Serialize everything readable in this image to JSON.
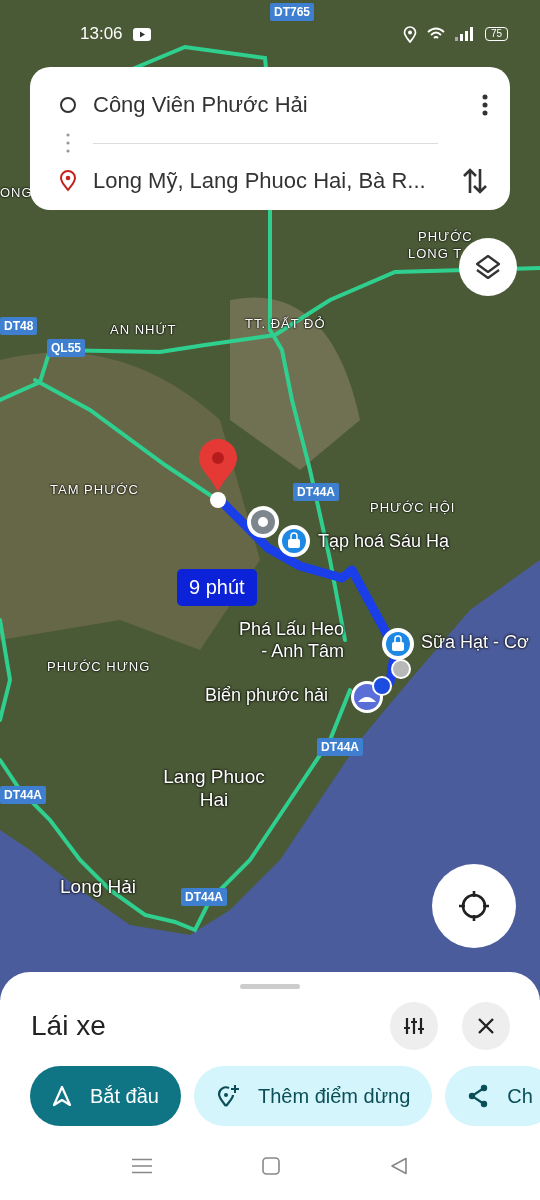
{
  "status_bar": {
    "time": "13:06",
    "battery": "75"
  },
  "directions": {
    "origin": "Công Viên Phước Hải",
    "destination": "Long Mỹ, Lang Phuoc Hai, Bà R..."
  },
  "map": {
    "labels": [
      {
        "kind": "shield",
        "text": "DT765"
      },
      {
        "kind": "area",
        "text": "ONG"
      },
      {
        "kind": "area",
        "text": "PHƯỚC"
      },
      {
        "kind": "area",
        "text": "LONG T"
      },
      {
        "kind": "shield",
        "text": "DT48"
      },
      {
        "kind": "area",
        "text": "AN NHỨT"
      },
      {
        "kind": "area",
        "text": "TT. ĐẤT ĐỎ"
      },
      {
        "kind": "shield",
        "text": "QL55"
      },
      {
        "kind": "area",
        "text": "TAM PHƯỚC"
      },
      {
        "kind": "shield",
        "text": "DT44A"
      },
      {
        "kind": "area",
        "text": "PHƯỚC HỘI"
      },
      {
        "kind": "poi",
        "text": "Tạp hoá Sáu Hạ"
      },
      {
        "kind": "poi",
        "text": "Phá Lấu Heo - Anh Tâm"
      },
      {
        "kind": "poi",
        "text": "Sữa Hạt - Cơ"
      },
      {
        "kind": "area",
        "text": "PHƯỚC HƯNG"
      },
      {
        "kind": "poi",
        "text": "Biển phước hải"
      },
      {
        "kind": "shield",
        "text": "DT44A"
      },
      {
        "kind": "shield",
        "text": "DT44A"
      },
      {
        "kind": "place",
        "text": "Lang Phuoc Hai"
      },
      {
        "kind": "place",
        "text": "Long Hải"
      },
      {
        "kind": "shield",
        "text": "DT44A"
      }
    ],
    "route": {
      "duration": "9 phút"
    }
  },
  "sheet": {
    "title": "Lái xe",
    "actions": [
      {
        "kind": "primary",
        "label": "Bắt đầu"
      },
      {
        "kind": "tonal",
        "label": "Thêm điểm dừng"
      },
      {
        "kind": "tonal",
        "label": "Ch"
      }
    ]
  }
}
